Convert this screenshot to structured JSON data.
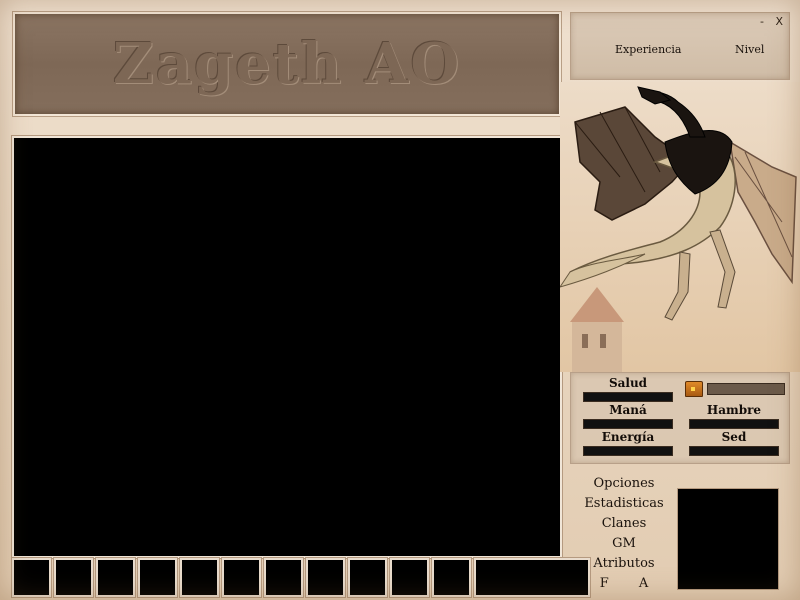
{
  "title": "Zageth AO",
  "window_controls": {
    "minimize": "-",
    "close": "X"
  },
  "top_bar": {
    "experience_label": "Experiencia",
    "level_label": "Nivel"
  },
  "stats": {
    "health_label": "Salud",
    "mana_label": "Maná",
    "hunger_label": "Hambre",
    "energy_label": "Energía",
    "thirst_label": "Sed"
  },
  "menu": {
    "items": [
      "Opciones",
      "Estadisticas",
      "Clanes",
      "GM",
      "Atributos"
    ],
    "f_label": "F",
    "a_label": "A"
  },
  "colors": {
    "banner": "#7e6856",
    "background": "#ead8c2",
    "viewport": "#000000"
  },
  "icons": {
    "gold": "treasure-chest-icon",
    "art": "dragon-illustration"
  }
}
